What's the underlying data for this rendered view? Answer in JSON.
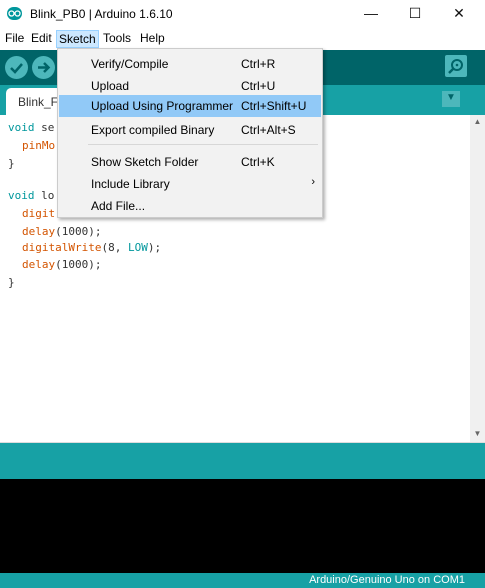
{
  "window": {
    "title": "Blink_PB0 | Arduino 1.6.10",
    "minimize_glyph": "—",
    "maximize_glyph": "☐",
    "close_glyph": "✕"
  },
  "menubar": {
    "items": [
      "File",
      "Edit",
      "Sketch",
      "Tools",
      "Help"
    ]
  },
  "sketch_menu": {
    "items": [
      {
        "label": "Verify/Compile",
        "shortcut": "Ctrl+R"
      },
      {
        "label": "Upload",
        "shortcut": "Ctrl+U"
      },
      {
        "label": "Upload Using Programmer",
        "shortcut": "Ctrl+Shift+U"
      },
      {
        "label": "Export compiled Binary",
        "shortcut": "Ctrl+Alt+S"
      },
      {
        "label": "Show Sketch Folder",
        "shortcut": "Ctrl+K"
      },
      {
        "label": "Include Library",
        "shortcut": "›"
      },
      {
        "label": "Add File...",
        "shortcut": ""
      }
    ],
    "highlighted_item": "Upload Using Programmer"
  },
  "toolbar": {
    "icons": [
      "verify-icon",
      "upload-icon",
      "serial-monitor-icon"
    ]
  },
  "tab": {
    "label": "Blink_F",
    "menu_glyph": "▼"
  },
  "code": {
    "line1": {
      "kw": "void",
      "rest": " se"
    },
    "line2": {
      "fn": "pinMo"
    },
    "line3": "}",
    "line5": {
      "kw": "void",
      "rest": " lo"
    },
    "line6": {
      "fn": "digit"
    },
    "line7": {
      "fn": "delay",
      "rest": "(1000);"
    },
    "line8": {
      "fn": "digitalWrite",
      "rest_a": "(8, ",
      "const": "LOW",
      "rest_b": ");"
    },
    "line9": {
      "fn": "delay",
      "rest": "(1000);"
    },
    "line10": "}"
  },
  "scrollbar": {
    "up": "▲",
    "down": "▼"
  },
  "status": {
    "board": "Arduino/Genuino Uno on COM1"
  },
  "colors": {
    "toolbar": "#006468",
    "tabstrip": "#17a1a5",
    "highlight": "#91c9f7",
    "keyword": "#00979c",
    "function": "#d35400"
  }
}
